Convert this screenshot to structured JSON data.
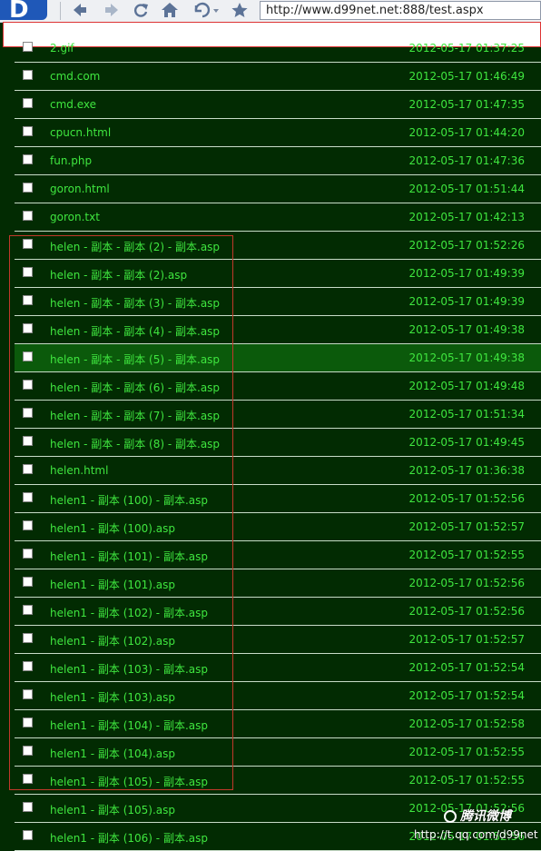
{
  "browser": {
    "logo_letter": "D",
    "address": "http://www.d99net.net:888/test.aspx",
    "icons": [
      "back-arrow-icon",
      "forward-arrow-icon",
      "refresh-icon",
      "home-icon",
      "undo-history-icon",
      "star-favorites-icon"
    ]
  },
  "files": [
    {
      "name": "2.gif",
      "date": "2012-05-17 01:37:25"
    },
    {
      "name": "cmd.com",
      "date": "2012-05-17 01:46:49"
    },
    {
      "name": "cmd.exe",
      "date": "2012-05-17 01:47:35"
    },
    {
      "name": "cpucn.html",
      "date": "2012-05-17 01:44:20"
    },
    {
      "name": "fun.php",
      "date": "2012-05-17 01:47:36"
    },
    {
      "name": "goron.html",
      "date": "2012-05-17 01:51:44"
    },
    {
      "name": "goron.txt",
      "date": "2012-05-17 01:42:13"
    },
    {
      "name": "helen - 副本 - 副本 (2) - 副本.asp",
      "date": "2012-05-17 01:52:26"
    },
    {
      "name": "helen - 副本 - 副本 (2).asp",
      "date": "2012-05-17 01:49:39"
    },
    {
      "name": "helen - 副本 - 副本 (3) - 副本.asp",
      "date": "2012-05-17 01:49:39"
    },
    {
      "name": "helen - 副本 - 副本 (4) - 副本.asp",
      "date": "2012-05-17 01:49:38"
    },
    {
      "name": "helen - 副本 - 副本 (5) - 副本.asp",
      "date": "2012-05-17 01:49:38"
    },
    {
      "name": "helen - 副本 - 副本 (6) - 副本.asp",
      "date": "2012-05-17 01:49:48"
    },
    {
      "name": "helen - 副本 - 副本 (7) - 副本.asp",
      "date": "2012-05-17 01:51:34"
    },
    {
      "name": "helen - 副本 - 副本 (8) - 副本.asp",
      "date": "2012-05-17 01:49:45"
    },
    {
      "name": "helen.html",
      "date": "2012-05-17 01:36:38"
    },
    {
      "name": "helen1 - 副本 (100) - 副本.asp",
      "date": "2012-05-17 01:52:56"
    },
    {
      "name": "helen1 - 副本 (100).asp",
      "date": "2012-05-17 01:52:57"
    },
    {
      "name": "helen1 - 副本 (101) - 副本.asp",
      "date": "2012-05-17 01:52:55"
    },
    {
      "name": "helen1 - 副本 (101).asp",
      "date": "2012-05-17 01:52:56"
    },
    {
      "name": "helen1 - 副本 (102) - 副本.asp",
      "date": "2012-05-17 01:52:56"
    },
    {
      "name": "helen1 - 副本 (102).asp",
      "date": "2012-05-17 01:52:57"
    },
    {
      "name": "helen1 - 副本 (103) - 副本.asp",
      "date": "2012-05-17 01:52:54"
    },
    {
      "name": "helen1 - 副本 (103).asp",
      "date": "2012-05-17 01:52:54"
    },
    {
      "name": "helen1 - 副本 (104) - 副本.asp",
      "date": "2012-05-17 01:52:58"
    },
    {
      "name": "helen1 - 副本 (104).asp",
      "date": "2012-05-17 01:52:55"
    },
    {
      "name": "helen1 - 副本 (105) - 副本.asp",
      "date": "2012-05-17 01:52:55"
    },
    {
      "name": "helen1 - 副本 (105).asp",
      "date": "2012-05-17 01:52:56"
    },
    {
      "name": "helen1 - 副本 (106) - 副本.asp",
      "date": "2012-05-17 01:52:56"
    }
  ],
  "highlighted_file_index": 11,
  "watermark": {
    "brand": "腾讯微博",
    "url": "http://t.qq.com/d99net"
  },
  "colors": {
    "background": "#022b02",
    "file_text": "#3fe63f",
    "row_highlight": "#0b5a0b",
    "selection_box": "#c0392b"
  }
}
